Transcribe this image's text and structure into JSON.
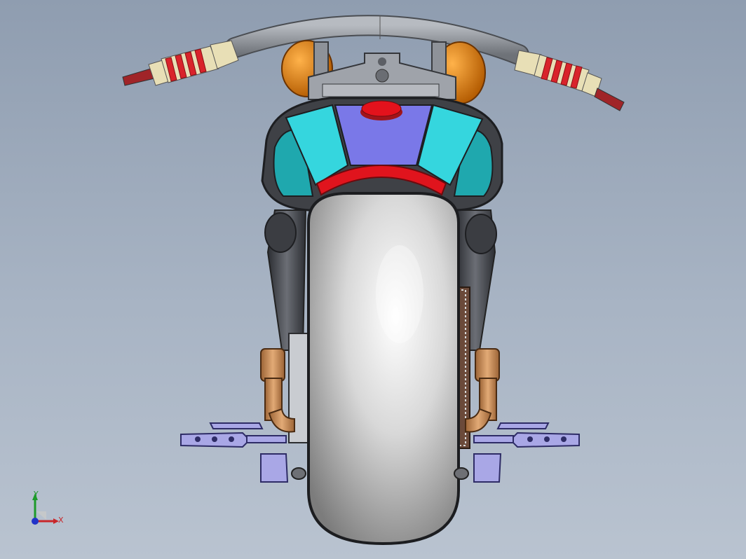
{
  "viewport": {
    "background_top": "#8f9db0",
    "background_bottom": "#b9c3d0"
  },
  "model": {
    "description_icon": "motorcycle-rear-view-model",
    "colors": {
      "tire": "#e6e6e6",
      "tank_cyan": "#35d6de",
      "tank_purple": "#7a78e8",
      "cap_red": "#e3121c",
      "fender_red": "#e0141d",
      "grip_red": "#d9232b",
      "grip_cream": "#e8dfb6",
      "light_orange": "#d47a0b",
      "pipe_bronze": "#c58a55",
      "peg_lavender": "#a9a7e6",
      "frame_dark": "#3d3f44",
      "handlebar": "#8a8e95"
    }
  },
  "triad": {
    "y_label": "Y",
    "x_label": "X",
    "y_color": "#1d9a2a",
    "x_color": "#c8262a",
    "z_color": "#2233c8"
  }
}
